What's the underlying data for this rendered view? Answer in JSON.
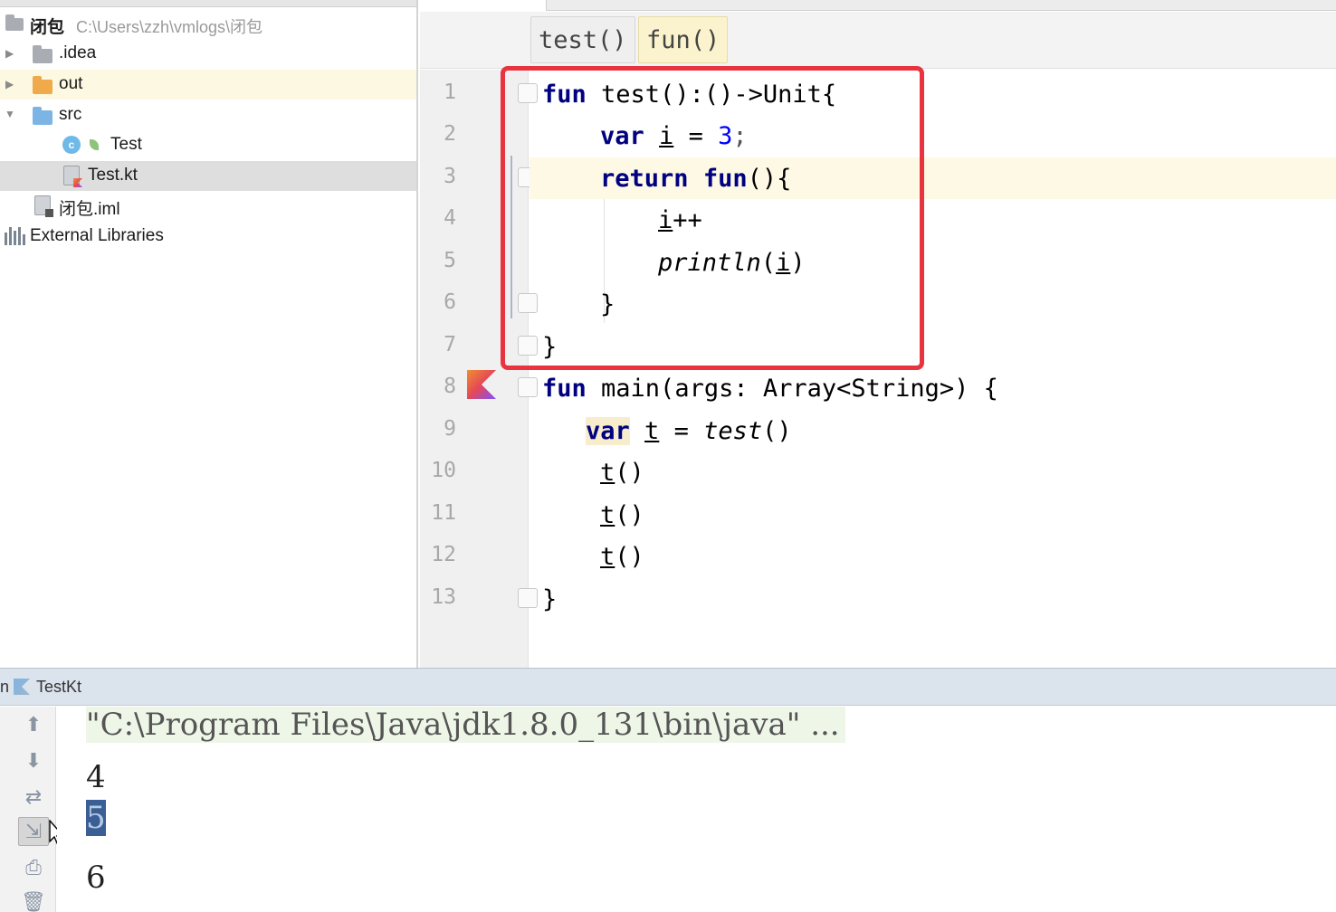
{
  "project": {
    "root": {
      "name": "闭包",
      "path": "C:\\Users\\zzh\\vmlogs\\闭包"
    },
    "items": [
      {
        "label": ".idea",
        "type": "folder"
      },
      {
        "label": "out",
        "type": "folder"
      },
      {
        "label": "src",
        "type": "folder"
      },
      {
        "label": "Test",
        "type": "class"
      },
      {
        "label": "Test.kt",
        "type": "kotlin-file"
      },
      {
        "label": "闭包.iml",
        "type": "iml-file"
      },
      {
        "label": "External Libraries",
        "type": "libraries"
      }
    ]
  },
  "editor": {
    "breadcrumbs": [
      "test()",
      "fun()"
    ],
    "line_numbers": [
      "1",
      "2",
      "3",
      "4",
      "5",
      "6",
      "7",
      "8",
      "9",
      "10",
      "11",
      "12",
      "13"
    ],
    "code": {
      "l1": {
        "kw": "fun",
        "rest": " test():()->Unit{"
      },
      "l2": {
        "kw": "var",
        "var": "i",
        "eq": " = ",
        "num": "3",
        "end": ";"
      },
      "l3": {
        "kw1": "return",
        "kw2": "fun",
        "rest": "(){"
      },
      "l4": {
        "var": "i",
        "rest": "++"
      },
      "l5": {
        "fn": "println",
        "open": "(",
        "var": "i",
        "close": ")"
      },
      "l6": {
        "text": "}"
      },
      "l7": {
        "text": "}"
      },
      "l8": {
        "kw": "fun",
        "rest": " main(args: Array<String>) {"
      },
      "l9": {
        "kw": "var",
        "var": "t",
        "eq": " = ",
        "fn": "test",
        "end": "()"
      },
      "l10": {
        "var": "t",
        "rest": "()"
      },
      "l11": {
        "var": "t",
        "rest": "()"
      },
      "l12": {
        "var": "t",
        "rest": "()"
      },
      "l13": {
        "text": "}"
      }
    }
  },
  "run": {
    "prefix": "n",
    "config_name": "TestKt",
    "command": "\"C:\\Program Files\\Java\\jdk1.8.0_131\\bin\\java\" ...",
    "output": [
      "4",
      "5",
      "6"
    ]
  },
  "colors": {
    "keyword": "#000080",
    "number": "#0000ff",
    "highlight_box": "#e8343f",
    "caret_line": "#fdf9e4",
    "selection": "#3a5f95"
  }
}
